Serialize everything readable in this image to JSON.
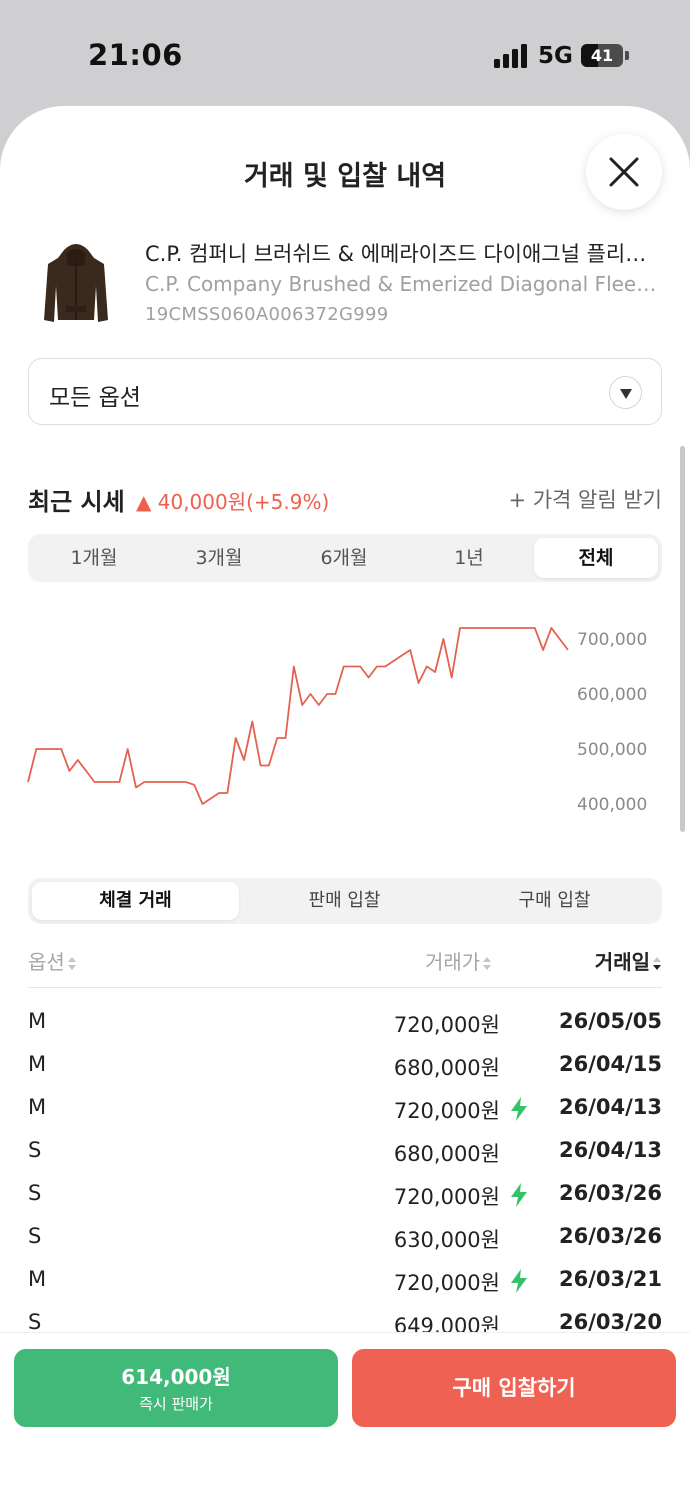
{
  "status_bar": {
    "time": "21:06",
    "network": "5G",
    "battery": "41",
    "battery_level": 0.41
  },
  "sheet": {
    "title": "거래 및 입찰 내역",
    "close_icon": "close-icon"
  },
  "product": {
    "name": "C.P. 컴퍼니 브러쉬드 & 에메라이즈드 다이애그널 플리스 후드 자켓 브라운",
    "name_en": "C.P. Company Brushed & Emerized Diagonal Fleece Hooded Jacket Brown",
    "code": "19CMSS060A006372G999"
  },
  "option_select": {
    "value": "모든 옵션",
    "icon": "chevron-down-icon"
  },
  "market": {
    "title": "최근 시세",
    "change": "▲ 40,000원(+5.9%)",
    "change_color": "#ef5f4e",
    "alert_label": "+ 가격 알림 받기"
  },
  "period_tabs": [
    {
      "label": "1개월",
      "active": false
    },
    {
      "label": "3개월",
      "active": false
    },
    {
      "label": "6개월",
      "active": false
    },
    {
      "label": "1년",
      "active": false
    },
    {
      "label": "전체",
      "active": true
    }
  ],
  "chart_data": {
    "type": "line",
    "y_ticks": [
      "700,000",
      "600,000",
      "500,000",
      "400,000"
    ],
    "ylim": [
      360000,
      760000
    ],
    "line_color": "#e4624f",
    "series": [
      {
        "values": [
          440000,
          500000,
          500000,
          500000,
          500000,
          460000,
          480000,
          460000,
          440000,
          440000,
          440000,
          440000,
          500000,
          430000,
          440000,
          440000,
          440000,
          440000,
          440000,
          440000,
          435000,
          400000,
          410000,
          420000,
          420000,
          520000,
          480000,
          550000,
          470000,
          470000,
          520000,
          520000,
          650000,
          580000,
          600000,
          580000,
          600000,
          600000,
          650000,
          650000,
          650000,
          630000,
          650000,
          650000,
          660000,
          670000,
          680000,
          620000,
          650000,
          640000,
          700000,
          630000,
          720000,
          720000,
          720000,
          720000,
          720000,
          720000,
          720000,
          720000,
          720000,
          720000,
          680000,
          720000,
          700000,
          680000
        ]
      }
    ]
  },
  "trade_tabs": [
    {
      "label": "체결 거래",
      "active": true
    },
    {
      "label": "판매 입찰",
      "active": false
    },
    {
      "label": "구매 입찰",
      "active": false
    }
  ],
  "table": {
    "headers": {
      "option": "옵션",
      "price": "거래가",
      "date": "거래일"
    },
    "rows": [
      {
        "option": "M",
        "price": "720,000원",
        "quick": false,
        "date": "26/05/05"
      },
      {
        "option": "M",
        "price": "680,000원",
        "quick": false,
        "date": "26/04/15"
      },
      {
        "option": "M",
        "price": "720,000원",
        "quick": true,
        "date": "26/04/13"
      },
      {
        "option": "S",
        "price": "680,000원",
        "quick": false,
        "date": "26/04/13"
      },
      {
        "option": "S",
        "price": "720,000원",
        "quick": true,
        "date": "26/03/26"
      },
      {
        "option": "S",
        "price": "630,000원",
        "quick": false,
        "date": "26/03/26"
      },
      {
        "option": "M",
        "price": "720,000원",
        "quick": true,
        "date": "26/03/21"
      },
      {
        "option": "S",
        "price": "649,000원",
        "quick": false,
        "date": "26/03/20"
      }
    ]
  },
  "bottom": {
    "sell_price": "614,000원",
    "sell_label": "즉시 판매가",
    "buy_label": "구매 입찰하기",
    "sell_color": "#41b979",
    "buy_color": "#ef6253"
  }
}
